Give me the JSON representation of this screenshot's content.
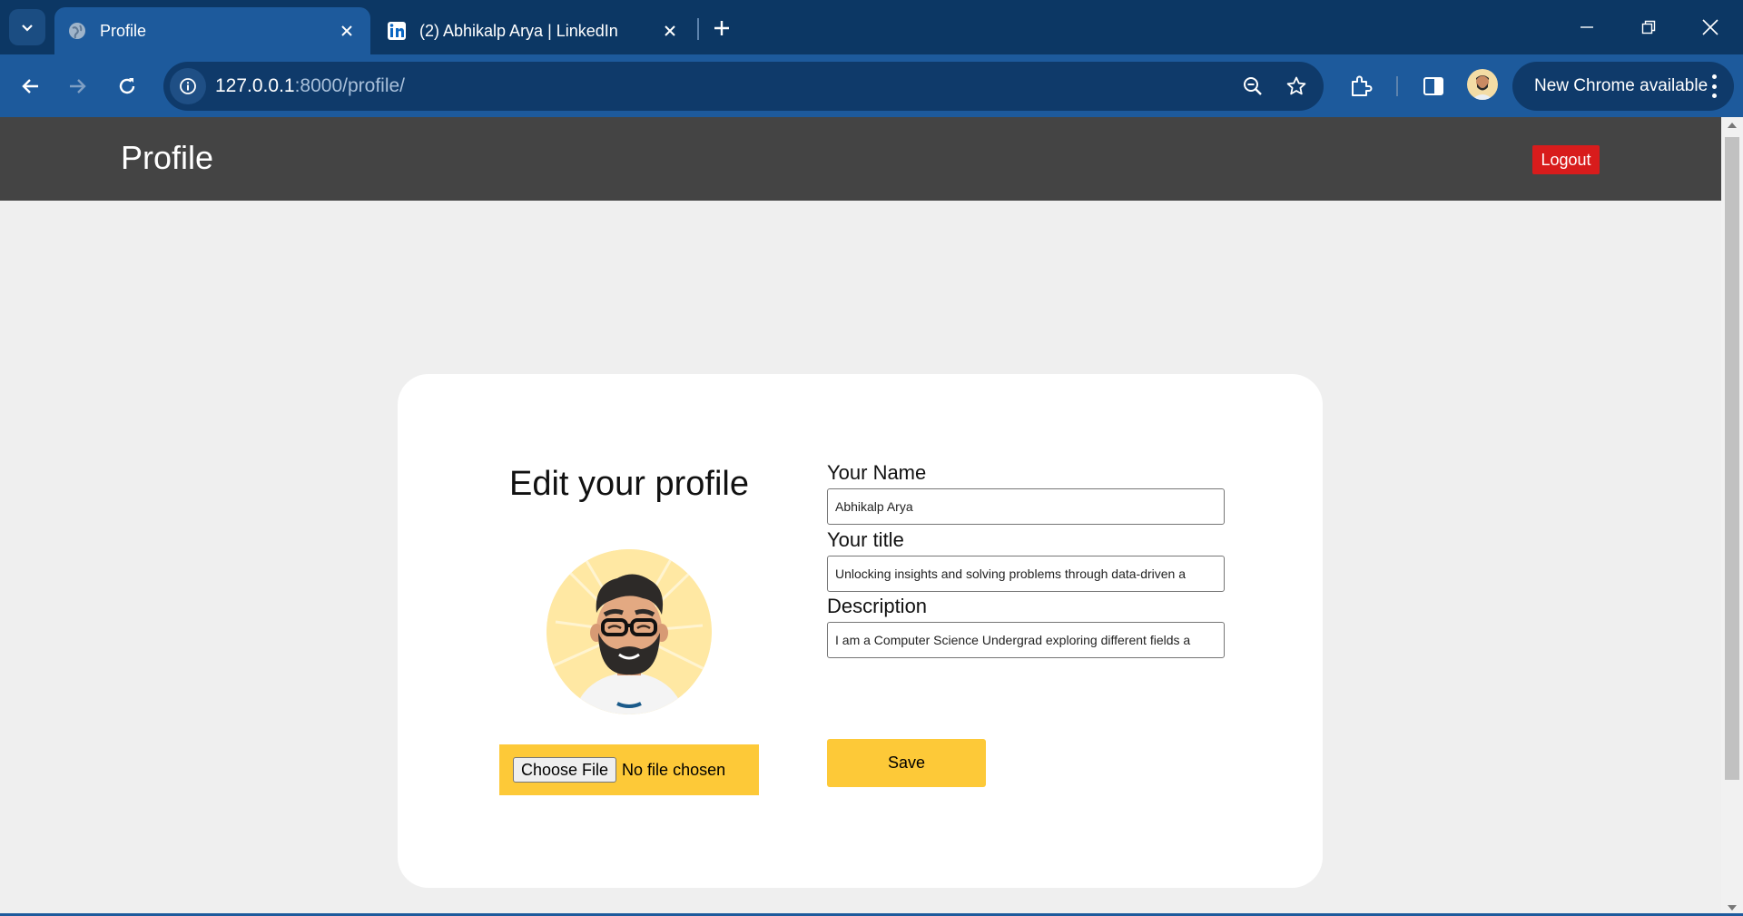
{
  "browser": {
    "tabs": [
      {
        "title": "Profile",
        "favicon": "globe-icon",
        "active": true
      },
      {
        "title": "(2) Abhikalp Arya | LinkedIn",
        "favicon": "linkedin-icon",
        "active": false
      }
    ],
    "url": {
      "host": "127.0.0.1",
      "rest": ":8000/profile/"
    },
    "chrome_update_label": "New Chrome available",
    "colors": {
      "tabstrip": "#0c3764",
      "toolbar": "#1d5a9c",
      "omnibox": "#0f3a6a"
    }
  },
  "navbar": {
    "brand": "Profile",
    "logout_label": "Logout"
  },
  "profile_form": {
    "heading": "Edit your profile",
    "file_button_label": "Choose File",
    "file_status": "No file chosen",
    "name_label": "Your Name",
    "name_value": "Abhikalp Arya",
    "title_label": "Your title",
    "title_value": "Unlocking insights and solving problems through data-driven a",
    "description_label": "Description",
    "description_value": "I am a Computer Science Undergrad exploring different fields a",
    "save_label": "Save",
    "colors": {
      "accent": "#fdc938",
      "logout": "#d81c1c",
      "navbar": "#444444"
    }
  }
}
